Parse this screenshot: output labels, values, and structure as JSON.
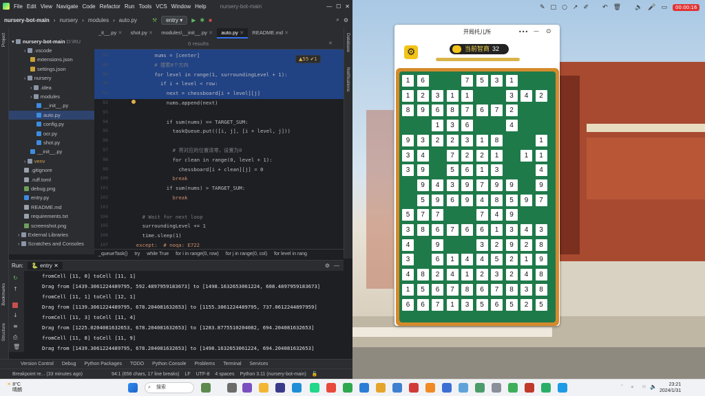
{
  "ide": {
    "menu": [
      "File",
      "Edit",
      "View",
      "Navigate",
      "Code",
      "Refactor",
      "Run",
      "Tools",
      "VCS",
      "Window",
      "Help"
    ],
    "window_title": "nursery-bot-main",
    "breadcrumb": [
      "nursery-bot-main",
      "nursery",
      "modules",
      "auto.py"
    ],
    "run_config": "entry",
    "left_tool_labels": [
      "Project",
      "Bookmarks",
      "Structure"
    ],
    "right_tool_labels": [
      "Database",
      "Notifications"
    ],
    "tree": {
      "root_label": "nursery-bot-main",
      "root_path": "D:\\RU",
      "items": [
        {
          "label": ".vscode",
          "type": "folder",
          "indent": 2
        },
        {
          "label": "extensions.json",
          "type": "json",
          "indent": 3
        },
        {
          "label": "settings.json",
          "type": "json",
          "indent": 3
        },
        {
          "label": "nursery",
          "type": "folder",
          "indent": 2
        },
        {
          "label": ".idea",
          "type": "folder",
          "indent": 3
        },
        {
          "label": "modules",
          "type": "folder",
          "indent": 3
        },
        {
          "label": "__init__.py",
          "type": "py",
          "indent": 4
        },
        {
          "label": "auto.py",
          "type": "py",
          "indent": 4,
          "selected": true
        },
        {
          "label": "config.py",
          "type": "py",
          "indent": 4
        },
        {
          "label": "ocr.py",
          "type": "py",
          "indent": 4
        },
        {
          "label": "shot.py",
          "type": "py",
          "indent": 4
        },
        {
          "label": "__init__.py",
          "type": "py",
          "indent": 3
        },
        {
          "label": "venv",
          "type": "folder",
          "indent": 2
        },
        {
          "label": ".gitignore",
          "type": "txt",
          "indent": 2
        },
        {
          "label": ".ruff.toml",
          "type": "txt",
          "indent": 2
        },
        {
          "label": "debug.png",
          "type": "img",
          "indent": 2
        },
        {
          "label": "entry.py",
          "type": "py",
          "indent": 2
        },
        {
          "label": "README.md",
          "type": "txt",
          "indent": 2
        },
        {
          "label": "requirements.txt",
          "type": "txt",
          "indent": 2
        },
        {
          "label": "screenshot.png",
          "type": "img",
          "indent": 2
        },
        {
          "label": "External Libraries",
          "type": "folder",
          "indent": 1
        },
        {
          "label": "Scratches and Consoles",
          "type": "folder",
          "indent": 1
        }
      ]
    },
    "tabs": [
      {
        "label": "_it__.py"
      },
      {
        "label": "shot.py"
      },
      {
        "label": "modules\\__init__.py"
      },
      {
        "label": "auto.py",
        "active": true
      },
      {
        "label": "README.md"
      }
    ],
    "find_results": "0 results",
    "inspections": "▲55  ✔1",
    "code_lines": [
      {
        "ln": "87",
        "code": "nums = [center]",
        "indent": 8,
        "hl": true
      },
      {
        "ln": "88",
        "code": "# 搜索8个方向",
        "indent": 8,
        "hl": true,
        "cls": "cm"
      },
      {
        "ln": "89",
        "code": "for level in range(1, surroundingLevel + 1):",
        "indent": 8,
        "hl": true
      },
      {
        "ln": "90",
        "code": "if i + level < row:",
        "indent": 10,
        "hl": true
      },
      {
        "ln": "91",
        "code": "next = chessboard[i + level][j]",
        "indent": 12,
        "hl": true
      },
      {
        "ln": "92",
        "code": "nums.append(next)",
        "indent": 12
      },
      {
        "ln": "93",
        "code": "",
        "indent": 0
      },
      {
        "ln": "94",
        "code": "if sum(nums) == TARGET_SUM:",
        "indent": 12
      },
      {
        "ln": "95",
        "code": "taskQueue.put(([i, j], [i + level, j]))",
        "indent": 14
      },
      {
        "ln": "96",
        "code": "",
        "indent": 0
      },
      {
        "ln": "97",
        "code": "# 将对应的位置清零，设置为0",
        "indent": 14,
        "cls": "cm"
      },
      {
        "ln": "98",
        "code": "for clean in range(0, level + 1):",
        "indent": 14
      },
      {
        "ln": "99",
        "code": "chessboard[i + clean][j] = 0",
        "indent": 16
      },
      {
        "ln": "100",
        "code": "break",
        "indent": 14,
        "cls": "kw"
      },
      {
        "ln": "101",
        "code": "if sum(nums) > TARGET_SUM:",
        "indent": 12
      },
      {
        "ln": "102",
        "code": "break",
        "indent": 14,
        "cls": "kw"
      },
      {
        "ln": "103",
        "code": "",
        "indent": 0
      },
      {
        "ln": "104",
        "code": "# Wait for next loop",
        "indent": 4,
        "cls": "cm"
      },
      {
        "ln": "105",
        "code": "surroundingLevel += 1",
        "indent": 4
      },
      {
        "ln": "106",
        "code": "time.sleep(1)",
        "indent": 4
      },
      {
        "ln": "107",
        "code": "except:  # noqa: E722",
        "indent": 2,
        "cls": "kw"
      }
    ],
    "code_breadcrumbs": [
      "_queueTask()",
      "try",
      "while True",
      "for i in range(0, row)",
      "for j in range(0, col)",
      "for level in rang"
    ],
    "run_tab": "Run:",
    "run_label": "entry",
    "console_lines": [
      "fromCell [11, 0] toCell [11, 1]",
      "Drag from [1439.3061224489795, 592.4897959183673] to [1498.1632653061224, 608.4897959183673]",
      "fromCell [11, 1] toCell [12, 1]",
      "Drag from [1139.3061224489795, 678.204081632653] to [1155.3061224489795, 737.0612244897959]",
      "fromCell [11, 3] toCell [11, 4]",
      "Drag from [1225.0204081632653, 678.204081632653] to [1283.8775510204082, 694.204081632653]",
      "fromCell [11, 8] toCell [11, 9]",
      "Drag from [1439.3061224489795, 678.204081632653] to [1498.1632653061224, 694.204081632653]"
    ],
    "bottom_tools": [
      "Version Control",
      "Debug",
      "Python Packages",
      "TODO",
      "Python Console",
      "Problems",
      "Terminal",
      "Services"
    ],
    "status": {
      "left": "Breakpoint re... (33 minutes ago)",
      "pos": "94:1 (656 chars, 17 line breaks)",
      "lf": "LF",
      "enc": "UTF-8",
      "indent": "4 spaces",
      "interp": "Python 3.11 (nursery-bot-main)"
    }
  },
  "recorder": {
    "time": "00:00:16"
  },
  "game": {
    "title": "开局托儿所",
    "score_label": "当前智商",
    "score_value": "32",
    "board": [
      [
        1,
        6,
        0,
        0,
        7,
        5,
        3,
        1,
        0,
        0
      ],
      [
        1,
        2,
        3,
        1,
        1,
        0,
        0,
        3,
        4,
        2
      ],
      [
        8,
        9,
        6,
        8,
        7,
        6,
        7,
        2,
        0,
        0
      ],
      [
        0,
        0,
        1,
        3,
        6,
        0,
        0,
        4,
        0,
        0
      ],
      [
        9,
        3,
        2,
        2,
        3,
        1,
        8,
        0,
        0,
        1
      ],
      [
        3,
        4,
        0,
        7,
        2,
        2,
        1,
        0,
        1,
        1
      ],
      [
        3,
        9,
        0,
        5,
        6,
        1,
        3,
        0,
        0,
        4
      ],
      [
        0,
        9,
        4,
        3,
        9,
        7,
        9,
        9,
        0,
        9
      ],
      [
        0,
        5,
        9,
        6,
        9,
        4,
        8,
        5,
        9,
        7
      ],
      [
        5,
        7,
        7,
        0,
        0,
        7,
        4,
        9,
        0,
        0
      ],
      [
        3,
        8,
        6,
        7,
        6,
        6,
        1,
        3,
        4,
        3
      ],
      [
        4,
        0,
        9,
        0,
        0,
        3,
        2,
        9,
        2,
        8
      ],
      [
        3,
        0,
        6,
        1,
        4,
        4,
        5,
        2,
        1,
        9
      ],
      [
        4,
        8,
        2,
        4,
        1,
        2,
        3,
        2,
        4,
        8
      ],
      [
        1,
        5,
        6,
        7,
        8,
        6,
        7,
        8,
        3,
        8
      ],
      [
        6,
        6,
        7,
        1,
        3,
        5,
        6,
        5,
        2,
        5
      ]
    ]
  },
  "taskbar": {
    "weather_temp": "8°C",
    "weather_desc": "晴朗",
    "search": "搜索",
    "time": "23:21",
    "date": "2024/1/31"
  }
}
